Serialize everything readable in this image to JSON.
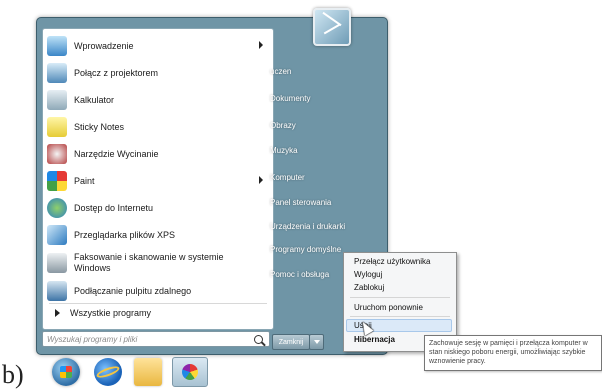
{
  "caption": "b)",
  "left_pane": {
    "programs": [
      {
        "label": "Wprowadzenie",
        "icon": "getting-started-icon",
        "has_arrow": true
      },
      {
        "label": "Połącz z projektorem",
        "icon": "projector-icon",
        "has_arrow": false
      },
      {
        "label": "Kalkulator",
        "icon": "calculator-icon",
        "has_arrow": false
      },
      {
        "label": "Sticky Notes",
        "icon": "sticky-notes-icon",
        "has_arrow": false
      },
      {
        "label": "Narzędzie Wycinanie",
        "icon": "snipping-tool-icon",
        "has_arrow": false
      },
      {
        "label": "Paint",
        "icon": "paint-icon",
        "has_arrow": true
      },
      {
        "label": "Dostęp do Internetu",
        "icon": "internet-icon",
        "has_arrow": false
      },
      {
        "label": "Przeglądarka plików XPS",
        "icon": "xps-viewer-icon",
        "has_arrow": false
      },
      {
        "label": "Faksowanie i skanowanie w systemie Windows",
        "icon": "fax-scan-icon",
        "has_arrow": false
      },
      {
        "label": "Podłączanie pulpitu zdalnego",
        "icon": "remote-desktop-icon",
        "has_arrow": false
      }
    ],
    "all_programs": "Wszystkie programy"
  },
  "search": {
    "placeholder": "Wyszukaj programy i pliki"
  },
  "right_pane": {
    "items": [
      "uczen",
      "Dokumenty",
      "Obrazy",
      "Muzyka",
      "Komputer",
      "Panel sterowania",
      "Urządzenia i drukarki",
      "Programy domyślne",
      "Pomoc i obsługa"
    ]
  },
  "shutdown_label": "Zamknij",
  "shutdown_submenu": {
    "items": [
      "Przełącz użytkownika",
      "Wyloguj",
      "Zablokuj",
      "Uruchom ponownie",
      "Uśpij",
      "Hibernacja"
    ],
    "highlighted": "Uśpij"
  },
  "tooltip": "Zachowuje sesję w pamięci i przełącza komputer w stan niskiego poboru energii, umożliwiając szybkie wznowienie pracy.",
  "taskbar": [
    "start-orb-icon",
    "internet-explorer-icon",
    "folder-icon",
    "paint-icon"
  ]
}
